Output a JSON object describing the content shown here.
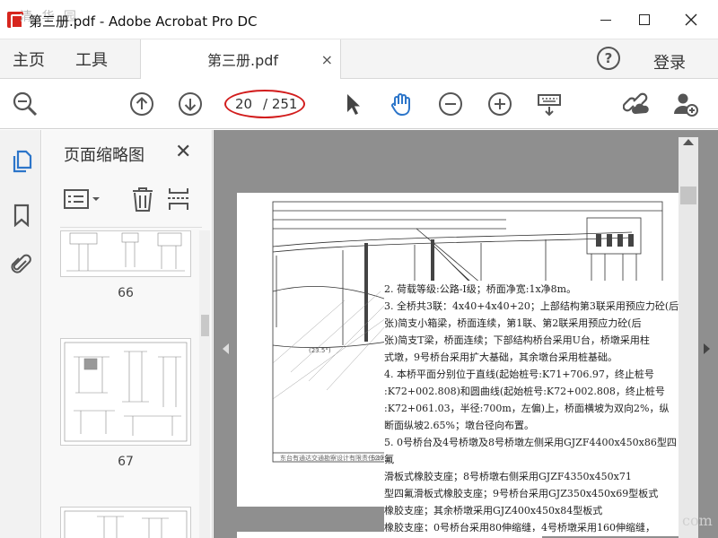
{
  "window": {
    "title": "第三册.pdf - Adobe Acrobat Pro DC",
    "watermark_top": "清 华 园",
    "minimize": "minimize",
    "maximize": "maximize",
    "close": "close"
  },
  "tabs": {
    "home": "主页",
    "tools": "工具",
    "document": "第三册.pdf",
    "close_glyph": "×",
    "help_glyph": "?",
    "login": "登录"
  },
  "toolbar": {
    "icons": [
      "zoom-search-icon",
      "page-up-icon",
      "page-down-icon",
      "select-arrow-icon",
      "hand-tool-icon",
      "zoom-out-icon",
      "zoom-in-icon",
      "keyboard-scroll-icon",
      "link-share-icon",
      "add-user-icon"
    ],
    "page_current": "20",
    "page_total": "/ 251",
    "highlight_color": "#d21d1d",
    "accent_color": "#2c75c9"
  },
  "rail": {
    "icons": [
      "pages-icon",
      "bookmark-icon",
      "attachment-icon"
    ]
  },
  "thumb_panel": {
    "title": "页面缩略图",
    "close_glyph": "✕",
    "tools": [
      "thumbnail-options-icon",
      "delete-icon",
      "page-extract-icon"
    ],
    "pages": [
      "66",
      "67"
    ]
  },
  "document": {
    "notes": [
      "2. 荷载等级:公路-Ⅰ级；桥面净宽:1x净8m。",
      "3. 全桥共3联：4x40+4x40+20；上部结构第3联采用预应力砼(后",
      "张)简支小箱梁，桥面连续，第1联、第2联采用预应力砼(后",
      "张)简支T梁，桥面连续；下部结构桥台采用U台，桥墩采用柱",
      "式墩，9号桥台采用扩大基础，其余墩台采用桩基础。",
      "4. 本桥平面分别位于直线(起始桩号:K71+706.97，终止桩号",
      ":K72+002.808)和圆曲线(起始桩号:K72+002.808，终止桩号",
      ":K72+061.03，半径:700m，左偏)上，桥面横坡为双向2%，纵",
      "断面纵坡2.65%；墩台径向布置。",
      "5. 0号桥台及4号桥墩及8号桥墩左侧采用GJZF4400x450x86型四氟",
      "滑板式橡胶支座；8号桥墩右侧采用GJZF4350x450x71",
      "型四氟滑板式橡胶支座；9号桥台采用GJZ350x450x69型板式",
      "橡胶支座；其余桥墩采用GJZ400x450x84型板式",
      "橡胶支座；0号桥台采用80伸缩缝，4号桥墩采用160伸缩缝，"
    ],
    "drawing_label": "(23.5°)",
    "stamp_left": "东台有通达交通勘察设计有限责任公司",
    "stamp_right": "S309线略东段",
    "watermark_bottom": "com"
  }
}
